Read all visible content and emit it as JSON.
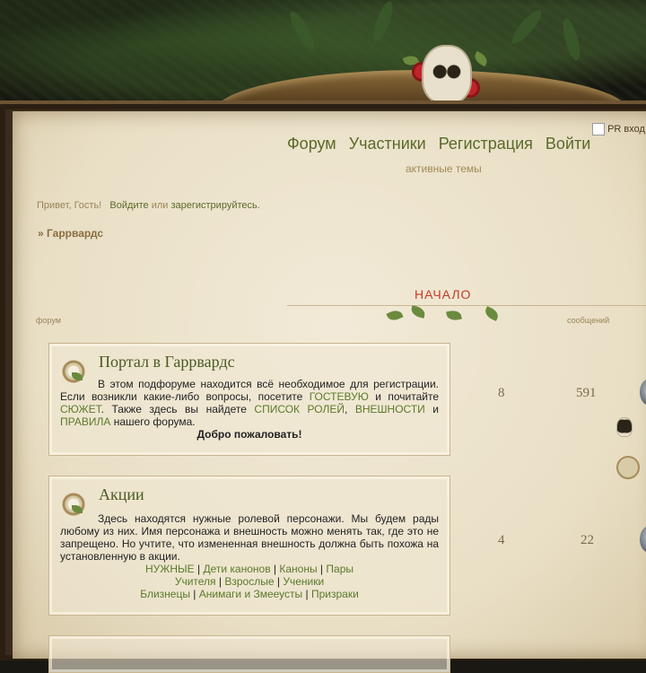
{
  "nav": {
    "items": [
      "Форум",
      "Участники",
      "Регистрация",
      "Войти"
    ],
    "pr_label": "PR вход"
  },
  "active_topics": "активные темы",
  "greeting": {
    "prefix": "Привет, Гость!",
    "login": "Войдите",
    "or": "или",
    "register": "зарегистрируйтесь."
  },
  "breadcrumb": "» Гаррвардс",
  "section": {
    "title": "НАЧАЛО",
    "col_forum": "форум",
    "col_posts": "сообщений"
  },
  "forums": [
    {
      "title": "Портал в Гаррвардс",
      "desc_1": "В этом подфоруме находится всё необходимое для регистрации. Если возникли какие-либо вопросы, посетите",
      "link_guest": "ГОСТЕВУЮ",
      "desc_2": "и почитайте",
      "link_plot": "СЮЖЕТ",
      "desc_3": ". Также здесь вы найдете",
      "link_roles": "СПИСОК РОЛЕЙ",
      "comma": ",",
      "link_looks": "ВНЕШНОСТИ",
      "and": "и",
      "link_rules": "ПРАВИЛА",
      "desc_4": "нашего форума.",
      "welcome": "Добро пожаловать!",
      "topics": "8",
      "posts": "591"
    },
    {
      "title": "Акции",
      "desc": "Здесь находятся нужные ролевой персонажи. Мы будем рады любому из них. Имя персонажа и внешность можно менять так, где это не запрещено. Но учтите, что измененная внешность должна быть похожа на установленную в акции.",
      "row1": [
        "НУЖНЫЕ",
        "Дети канонов",
        "Каноны",
        "Пары"
      ],
      "row2": [
        "Учителя",
        "Взрослые",
        "Ученики"
      ],
      "row3": [
        "Близнецы",
        "Анимаги и Змееусты",
        "Призраки"
      ],
      "sep": " | ",
      "topics": "4",
      "posts": "22"
    }
  ],
  "colors": {
    "link": "#5a7a2a",
    "nav": "#5a6a2a",
    "accent": "#c43a2a"
  }
}
